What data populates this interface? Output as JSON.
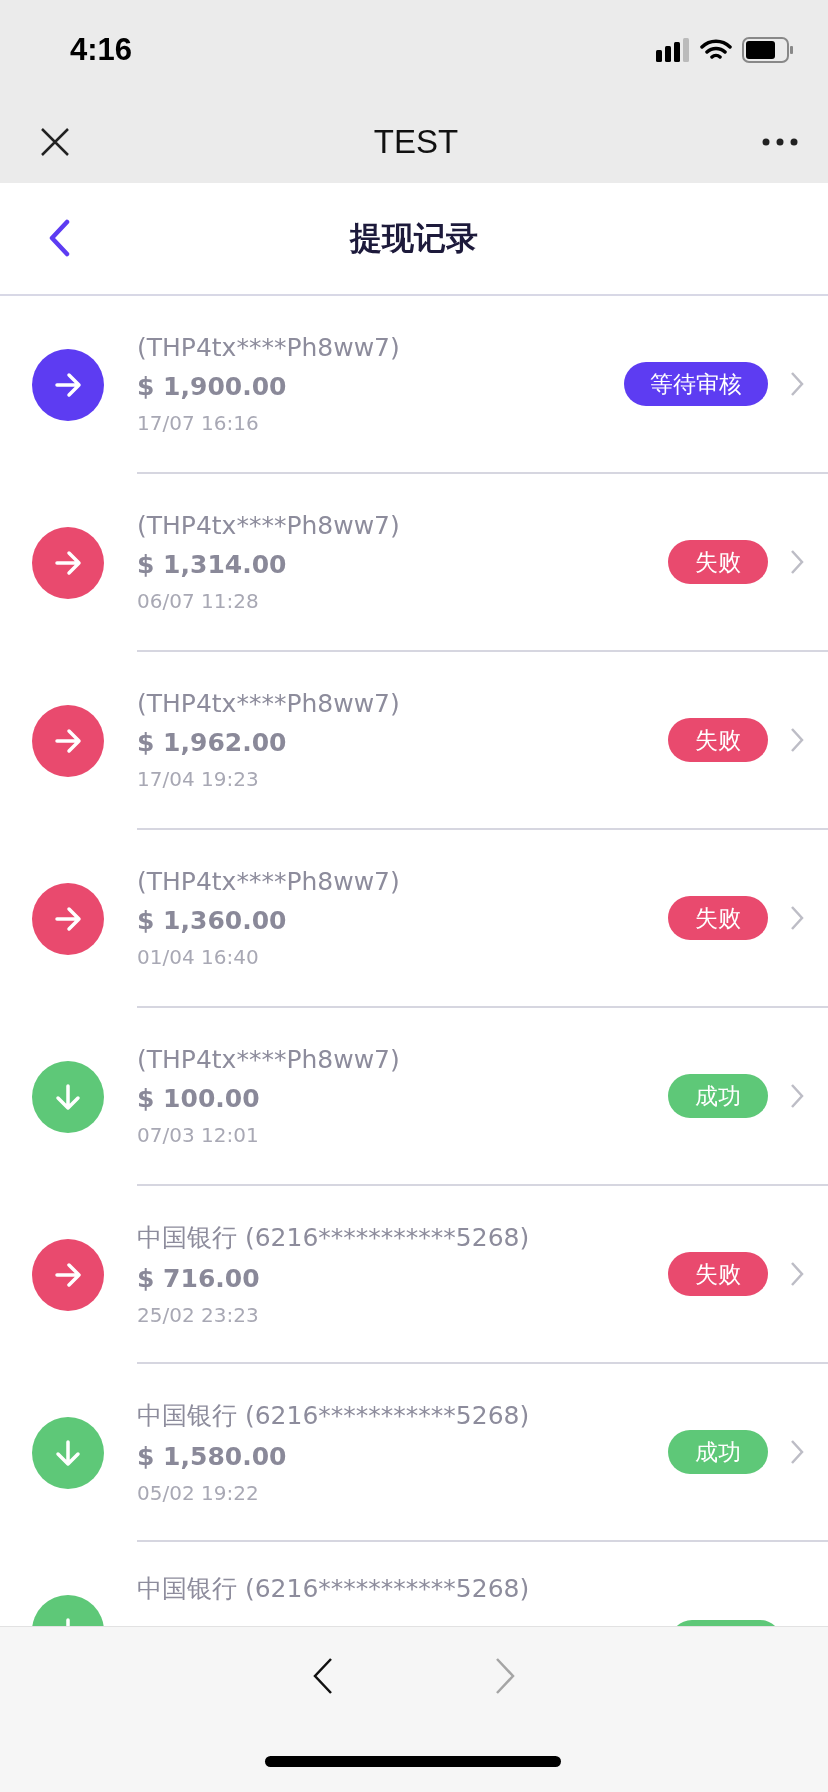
{
  "status_bar": {
    "time": "4:16"
  },
  "browser_bar": {
    "title": "TEST"
  },
  "header": {
    "title": "提现记录"
  },
  "records": [
    {
      "account": "(THP4tx****Ph8ww7)",
      "amount": "$ 1,900.00",
      "date": "17/07 16:16",
      "kind": "pending",
      "badge": "等待审核"
    },
    {
      "account": "(THP4tx****Ph8ww7)",
      "amount": "$ 1,314.00",
      "date": "06/07 11:28",
      "kind": "failed",
      "badge": "失败"
    },
    {
      "account": "(THP4tx****Ph8ww7)",
      "amount": "$ 1,962.00",
      "date": "17/04 19:23",
      "kind": "failed",
      "badge": "失败"
    },
    {
      "account": "(THP4tx****Ph8ww7)",
      "amount": "$ 1,360.00",
      "date": "01/04 16:40",
      "kind": "failed",
      "badge": "失败"
    },
    {
      "account": "(THP4tx****Ph8ww7)",
      "amount": "$ 100.00",
      "date": "07/03 12:01",
      "kind": "success",
      "badge": "成功"
    },
    {
      "account": "中国银行 (6216***********5268)",
      "amount": "$ 716.00",
      "date": "25/02 23:23",
      "kind": "failed",
      "badge": "失败"
    },
    {
      "account": "中国银行 (6216***********5268)",
      "amount": "$ 1,580.00",
      "date": "05/02 19:22",
      "kind": "success",
      "badge": "成功"
    },
    {
      "account": "中国银行 (6216***********5268)",
      "kind": "success"
    }
  ],
  "bottom_bar": {
    "back": {
      "disabled": false
    },
    "forward": {
      "disabled": true
    }
  }
}
